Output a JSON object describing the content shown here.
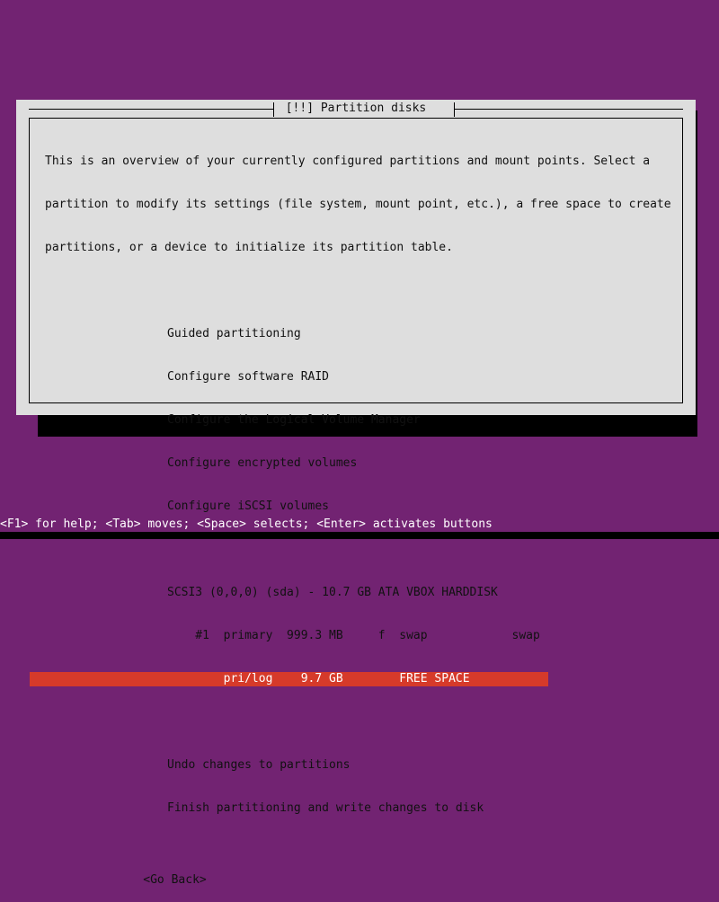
{
  "colors": {
    "background_purple": "#722372",
    "dialog_bg": "#dedede",
    "title_red": "#d63a2a",
    "highlight_red": "#d63a2a",
    "text_black": "#111111",
    "helpbar_text": "#ffffff",
    "shadow_black": "#000000"
  },
  "dialog": {
    "title": "[!!] Partition disks",
    "description": [
      "This is an overview of your currently configured partitions and mount points. Select a",
      "partition to modify its settings (file system, mount point, etc.), a free space to create",
      "partitions, or a device to initialize its partition table."
    ],
    "menu_items": [
      {
        "label": "Guided partitioning"
      },
      {
        "label": "Configure software RAID"
      },
      {
        "label": "Configure the Logical Volume Manager"
      },
      {
        "label": "Configure encrypted volumes"
      },
      {
        "label": "Configure iSCSI volumes"
      }
    ],
    "disk": {
      "header": "SCSI3 (0,0,0) (sda) - 10.7 GB ATA VBOX HARDDISK",
      "partitions": [
        {
          "text": "    #1  primary  999.3 MB     f  swap            swap",
          "selected": false
        },
        {
          "text": "        pri/log    9.7 GB        FREE SPACE",
          "selected": true
        }
      ]
    },
    "action_items": [
      {
        "label": "Undo changes to partitions"
      },
      {
        "label": "Finish partitioning and write changes to disk"
      }
    ],
    "go_back_button": "<Go Back>"
  },
  "helpbar": {
    "text": "<F1> for help; <Tab> moves; <Space> selects; <Enter> activates buttons"
  }
}
